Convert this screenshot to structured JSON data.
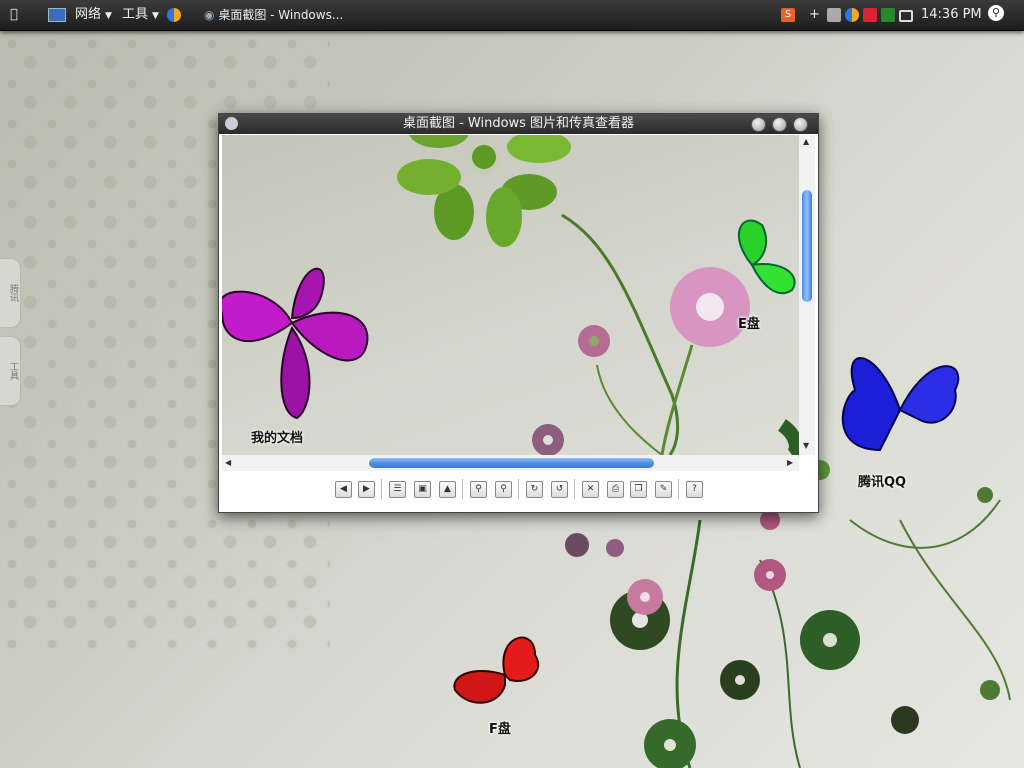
{
  "panel": {
    "menu_network": "网络",
    "menu_tools": "工具",
    "task_title": "桌面截图 - Windows...",
    "plus": "+",
    "clock": "14:36 PM"
  },
  "window": {
    "title": "桌面截图 - Windows 图片和传真查看器"
  },
  "desktop": {
    "label_my_docs": "我的文档",
    "label_e_drive": "E盘",
    "label_qq": "腾讯QQ",
    "label_f_drive": "F盘",
    "sidetab_top": "腾讯",
    "sidetab_bottom": "工具"
  },
  "toolbar": {
    "help_glyph": "?"
  }
}
